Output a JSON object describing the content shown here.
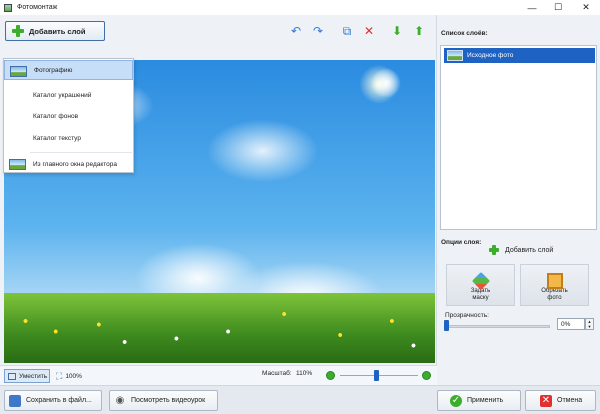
{
  "window": {
    "title": "Фотомонтаж",
    "minimize_glyph": "—",
    "maximize_glyph": "☐",
    "close_glyph": "✕"
  },
  "toolbar": {
    "add_layer_label": "Добавить слой",
    "icons": [
      "undo-icon",
      "redo-icon",
      "copy-icon",
      "delete-icon",
      "move-down-icon",
      "move-up-icon"
    ]
  },
  "add_layer_menu": {
    "items": [
      {
        "label": "Фотографию",
        "selected": true
      },
      {
        "label": "Каталог украшений"
      },
      {
        "label": "Каталог фонов"
      },
      {
        "label": "Каталог текстур"
      },
      {
        "label": "Из главного окна редактора"
      }
    ]
  },
  "status_bar": {
    "fit_label": "Уместить",
    "zoom_100_label": "100%",
    "scale_label": "Масштаб:",
    "scale_value": "110%"
  },
  "layers_panel": {
    "title": "Список слоёв:",
    "items": [
      {
        "label": "Исходное фото",
        "selected": true
      }
    ],
    "add_layer_label": "Добавить слой"
  },
  "layer_options": {
    "title": "Опции слоя:",
    "set_mask_label_1": "Задать",
    "set_mask_label_2": "маску",
    "crop_label_1": "Обрезать",
    "crop_label_2": "фото",
    "transparency_label": "Прозрачность:",
    "transparency_value": "0%"
  },
  "footer": {
    "save_label": "Сохранить в файл...",
    "video_label": "Посмотреть видеоурок",
    "apply_label": "Применить",
    "cancel_label": "Отмена"
  },
  "colors": {
    "accent": "#1e63c4",
    "green": "#3dae2b",
    "red": "#e0302f"
  }
}
